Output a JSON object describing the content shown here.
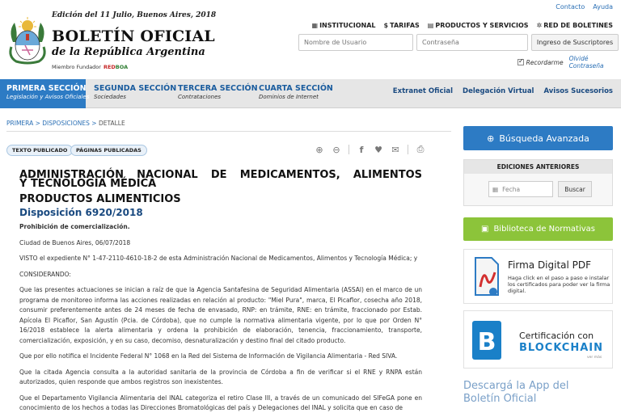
{
  "header": {
    "edition": "Edición del 11 Julio, Buenos Aires, 2018",
    "title": "BOLETÍN OFICIAL",
    "subtitle": "de la República Argentina",
    "miembro": "Miembro Fundador",
    "redboa_red": "RED",
    "redboa_boa": "BOA",
    "top_links": [
      "Contacto",
      "Ayuda"
    ],
    "main_links": [
      {
        "icon": "building-icon",
        "label": "INSTITUCIONAL"
      },
      {
        "icon": "dollar-icon",
        "label": "TARIFAS"
      },
      {
        "icon": "cart-icon",
        "label": "PRODUCTOS Y SERVICIOS"
      },
      {
        "icon": "share-icon",
        "label": "RED DE BOLETINES"
      }
    ],
    "login": {
      "user_placeholder": "Nombre de Usuario",
      "pass_placeholder": "Contraseña",
      "submit": "Ingreso de Suscriptores",
      "remember": "Recordarme",
      "forgot": "Olvidé Contraseña"
    }
  },
  "nav": {
    "sections": [
      {
        "title": "PRIMERA SECCIÓN",
        "sub": "Legislación y Avisos Oficiales",
        "active": true
      },
      {
        "title": "SEGUNDA SECCIÓN",
        "sub": "Sociedades"
      },
      {
        "title": "TERCERA SECCIÓN",
        "sub": "Contrataciones"
      },
      {
        "title": "CUARTA SECCIÓN",
        "sub": "Dominios de Internet"
      }
    ],
    "right": [
      "Extranet Oficial",
      "Delegación Virtual",
      "Avisos Sucesorios"
    ]
  },
  "breadcrumb": {
    "p1": "PRIMERA",
    "p2": "DISPOSICIONES",
    "current": "DETALLE",
    "sep": ">"
  },
  "toolbar": {
    "pill1": "TEXTO PUBLICADO",
    "pill2": "PÁGINAS PUBLICADAS"
  },
  "article": {
    "h1": "ADMINISTRACIÓN NACIONAL DE MEDICAMENTOS, ALIMENTOS",
    "h1b": "Y TECNOLOGÍA MÉDICA",
    "h2": "PRODUCTOS ALIMENTICIOS",
    "h3": "Disposición 6920/2018",
    "lead": "Prohibición de comercialización.",
    "p1": "Ciudad de Buenos Aires, 06/07/2018",
    "p2": "VISTO el expediente N° 1-47-2110-4610-18-2 de esta Administración Nacional de Medicamentos, Alimentos y Tecnología Médica; y",
    "p3": "CONSIDERANDO:",
    "p4": "Que las presentes actuaciones se inician a raíz de que la Agencia Santafesina de Seguridad Alimentaria (ASSAl) en el marco de un programa de monitoreo informa las acciones realizadas en relación al producto: \"Miel Pura\", marca, El Picaflor, cosecha año 2018, consumir preferentemente antes de 24 meses de fecha de envasado, RNP: en trámite, RNE: en trámite, fraccionado por Estab. Apícola El Picaflor, San Agustín (Pcia. de Córdoba), que no cumple la normativa alimentaria vigente, por lo que por Orden N° 16/2018 establece la alerta alimentaria y ordena la prohibición de elaboración, tenencia, fraccionamiento, transporte, comercialización, exposición, y en su caso, decomiso, desnaturalización y destino final del citado producto.",
    "p5": "Que por ello notifica el Incidente Federal N° 1068 en la Red del Sistema de Información de Vigilancia Alimentaria - Red SIVA.",
    "p6": "Que la citada Agencia consulta a la autoridad sanitaria de la provincia de Córdoba a fin de verificar si el RNE y RNPA están autorizados, quien responde que ambos registros son inexistentes.",
    "p7": "Que el Departamento Vigilancia Alimentaria del INAL categoriza el retiro Clase III, a través de un comunicado del SIFeGA pone en conocimiento de los hechos a todas las Direcciones Bromatológicas del país y Delegaciones del INAL y solicita que en caso de"
  },
  "sidebar": {
    "adv_search": "Búsqueda Avanzada",
    "ediciones_title": "EDICIONES ANTERIORES",
    "date_placeholder": "Fecha",
    "buscar": "Buscar",
    "biblioteca": "Biblioteca de Normativas",
    "firma_title": "Firma Digital PDF",
    "firma_text": "Haga click en el paso a paso e instalar los certificados para poder ver la firma digital.",
    "cert1": "Certificación con",
    "cert2": "BLOCKCHAIN",
    "ver_mas": "ver más",
    "app_line1": "Descargá la App del",
    "app_line2": "Boletín Oficial"
  },
  "colors": {
    "primary": "#2d7bc4",
    "green": "#8cc43a",
    "nav_bg": "#e6e6e6"
  }
}
